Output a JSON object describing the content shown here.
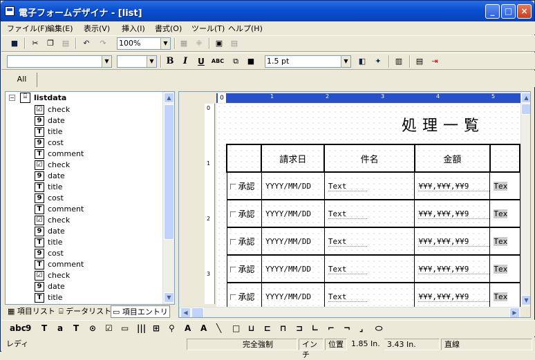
{
  "window": {
    "title": "電子フォームデザイナ - [list]",
    "minimize": "_",
    "maximize": "□",
    "close": "×"
  },
  "menu": [
    "ファイル(F)",
    "編集(E)",
    "表示(V)",
    "挿入(I)",
    "書式(O)",
    "ツール(T)",
    "ヘルプ(H)"
  ],
  "toolbar1": {
    "zoom": "100%"
  },
  "toolbar2": {
    "font": "",
    "size": "",
    "bold": "B",
    "italic": "I",
    "underline": "U",
    "abc": "ABC",
    "line_width": "1.5 pt"
  },
  "tabs": {
    "all": "All"
  },
  "tree": {
    "root": "listdata",
    "items": [
      {
        "icon": "checkbox-icon",
        "glyph": "☑",
        "label": "check"
      },
      {
        "icon": "number-icon",
        "glyph": "9",
        "label": "date"
      },
      {
        "icon": "text-icon",
        "glyph": "T",
        "label": "title"
      },
      {
        "icon": "number-icon",
        "glyph": "9",
        "label": "cost"
      },
      {
        "icon": "text-icon",
        "glyph": "T",
        "label": "comment"
      },
      {
        "icon": "checkbox-icon",
        "glyph": "☑",
        "label": "check"
      },
      {
        "icon": "number-icon",
        "glyph": "9",
        "label": "date"
      },
      {
        "icon": "text-icon",
        "glyph": "T",
        "label": "title"
      },
      {
        "icon": "number-icon",
        "glyph": "9",
        "label": "cost"
      },
      {
        "icon": "text-icon",
        "glyph": "T",
        "label": "comment"
      },
      {
        "icon": "checkbox-icon",
        "glyph": "☑",
        "label": "check"
      },
      {
        "icon": "number-icon",
        "glyph": "9",
        "label": "date"
      },
      {
        "icon": "text-icon",
        "glyph": "T",
        "label": "title"
      },
      {
        "icon": "number-icon",
        "glyph": "9",
        "label": "cost"
      },
      {
        "icon": "text-icon",
        "glyph": "T",
        "label": "comment"
      },
      {
        "icon": "checkbox-icon",
        "glyph": "☑",
        "label": "check"
      },
      {
        "icon": "number-icon",
        "glyph": "9",
        "label": "date"
      },
      {
        "icon": "text-icon",
        "glyph": "T",
        "label": "title"
      }
    ]
  },
  "pane_tabs": [
    "項目リスト",
    "データリスト",
    "項目エントリ"
  ],
  "ruler": {
    "origin": "0",
    "marks": [
      "1",
      "2",
      "3",
      "4",
      "5"
    ]
  },
  "vruler": {
    "marks": [
      "0",
      "1",
      "2",
      "3"
    ]
  },
  "form": {
    "title": "処理一覧",
    "headers": [
      "",
      "請求日",
      "件名",
      "金額",
      ""
    ],
    "rows": [
      {
        "check": "承認",
        "date": "YYYY/MM/DD",
        "title": "Text",
        "cost": "¥¥¥,¥¥¥,¥¥9",
        "extra": "Tex"
      },
      {
        "check": "承認",
        "date": "YYYY/MM/DD",
        "title": "Text",
        "cost": "¥¥¥,¥¥¥,¥¥9",
        "extra": "Tex"
      },
      {
        "check": "承認",
        "date": "YYYY/MM/DD",
        "title": "Text",
        "cost": "¥¥¥,¥¥¥,¥¥9",
        "extra": "Tex"
      },
      {
        "check": "承認",
        "date": "YYYY/MM/DD",
        "title": "Text",
        "cost": "¥¥¥,¥¥¥,¥¥9",
        "extra": "Tex"
      },
      {
        "check": "承認",
        "date": "YYYY/MM/DD",
        "title": "Text",
        "cost": "¥¥¥,¥¥¥,¥¥9",
        "extra": "Tex"
      }
    ]
  },
  "toolbox": [
    "abc",
    "9",
    "T",
    "a",
    "T",
    "⊙",
    "☑",
    "▭",
    "|||",
    "⊞",
    "⚲",
    "A",
    "A",
    "╲",
    "□",
    "⊔",
    "⊏",
    "⊓",
    "⊐",
    "∟",
    "⌐",
    "¬",
    "⌟",
    "⬭"
  ],
  "status": {
    "ready": "レディ",
    "mode": "完全強制",
    "unit": "インチ",
    "pos_label": "位置",
    "x": "1.85 In.",
    "y": "3.43 In.",
    "shape": "直線"
  }
}
